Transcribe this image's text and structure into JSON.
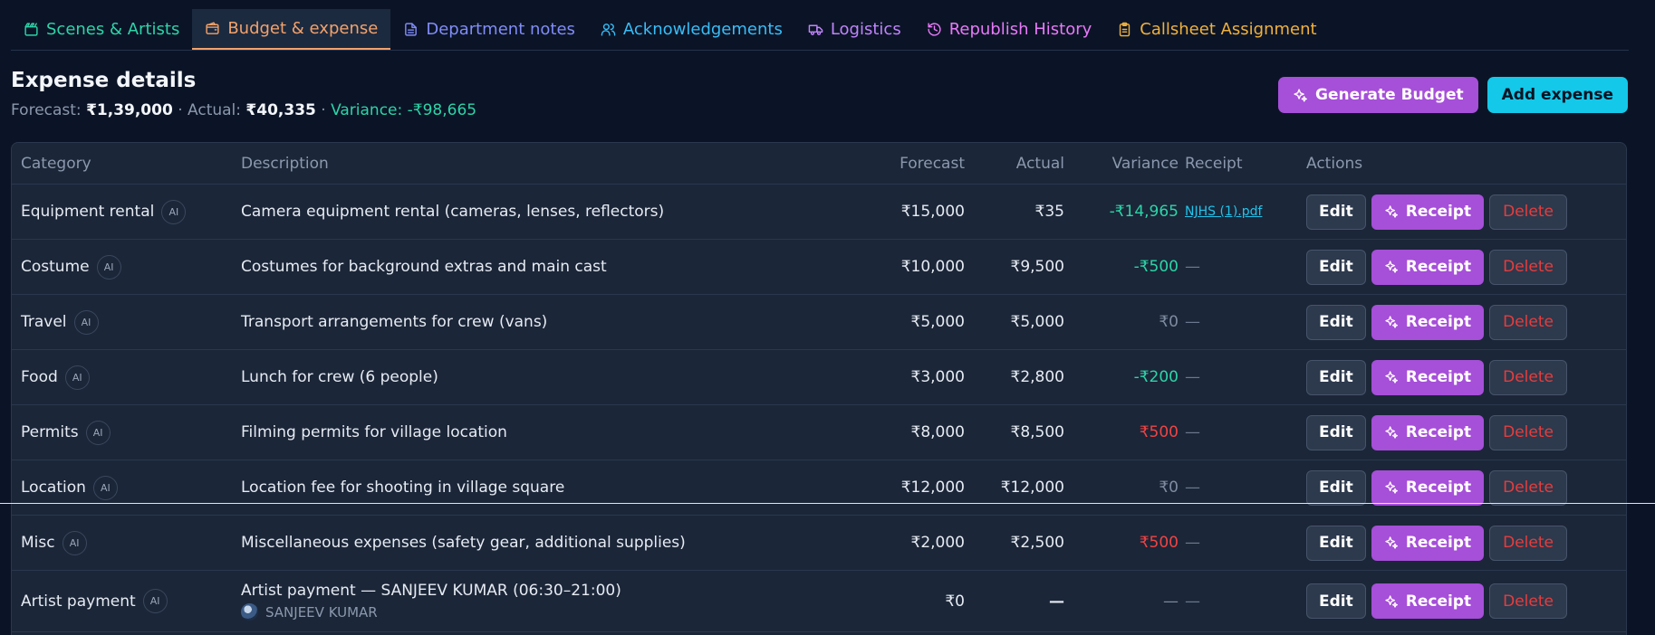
{
  "tabs": [
    {
      "label": "Scenes & Artists",
      "color": "#2dd4a8"
    },
    {
      "label": "Budget & expense",
      "color": "#f3a26b"
    },
    {
      "label": "Department notes",
      "color": "#818cf8"
    },
    {
      "label": "Acknowledgements",
      "color": "#38bdf8"
    },
    {
      "label": "Logistics",
      "color": "#c084fc"
    },
    {
      "label": "Republish History",
      "color": "#e879f9"
    },
    {
      "label": "Callsheet Assignment",
      "color": "#f0b13c"
    }
  ],
  "header": {
    "title": "Expense details",
    "forecast_label": "Forecast:",
    "forecast_value": "₹1,39,000",
    "sep": "·",
    "actual_label": "Actual:",
    "actual_value": "₹40,335",
    "variance_text": "Variance: -₹98,665"
  },
  "buttons": {
    "generate": "Generate Budget",
    "add": "Add expense"
  },
  "columns": {
    "category": "Category",
    "description": "Description",
    "forecast": "Forecast",
    "actual": "Actual",
    "variance": "Variance",
    "receipt": "Receipt",
    "actions": "Actions"
  },
  "ai_badge": "AI",
  "row_actions": {
    "edit": "Edit",
    "receipt": "Receipt",
    "delete": "Delete"
  },
  "rows": [
    {
      "category": "Equipment rental",
      "description": "Camera equipment rental (cameras, lenses, reflectors)",
      "forecast": "₹15,000",
      "actual": "₹35",
      "variance": "-₹14,965",
      "receipt": "NJHS (1).pdf"
    },
    {
      "category": "Costume",
      "description": "Costumes for background extras and main cast",
      "forecast": "₹10,000",
      "actual": "₹9,500",
      "variance": "-₹500",
      "receipt": "—"
    },
    {
      "category": "Travel",
      "description": "Transport arrangements for crew (vans)",
      "forecast": "₹5,000",
      "actual": "₹5,000",
      "variance": "₹0",
      "receipt": "—"
    },
    {
      "category": "Food",
      "description": "Lunch for crew (6 people)",
      "forecast": "₹3,000",
      "actual": "₹2,800",
      "variance": "-₹200",
      "receipt": "—"
    },
    {
      "category": "Permits",
      "description": "Filming permits for village location",
      "forecast": "₹8,000",
      "actual": "₹8,500",
      "variance": "₹500",
      "receipt": "—"
    },
    {
      "category": "Location",
      "description": "Location fee for shooting in village square",
      "forecast": "₹12,000",
      "actual": "₹12,000",
      "variance": "₹0",
      "receipt": "—"
    },
    {
      "category": "Misc",
      "description": "Miscellaneous expenses (safety gear, additional supplies)",
      "forecast": "₹2,000",
      "actual": "₹2,500",
      "variance": "₹500",
      "receipt": "—"
    },
    {
      "category": "Artist payment",
      "description": "Artist payment — SANJEEV KUMAR (06:30–21:00)",
      "sub_name": "SANJEEV KUMAR",
      "forecast": "₹0",
      "actual": "—",
      "variance": "—",
      "receipt": "—"
    }
  ]
}
